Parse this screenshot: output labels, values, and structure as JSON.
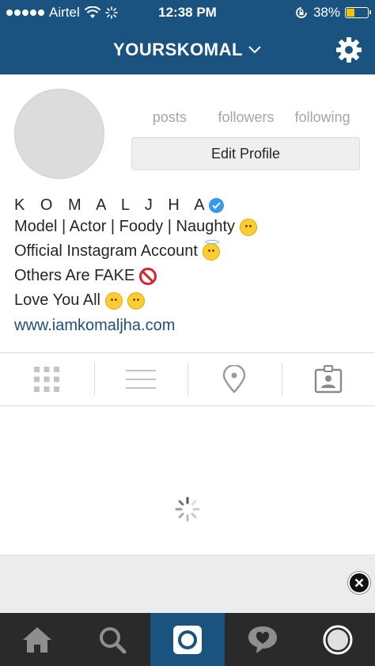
{
  "status_bar": {
    "carrier": "Airtel",
    "time": "12:38 PM",
    "battery_percent": "38%",
    "battery_level": 0.38
  },
  "nav": {
    "username": "YOURSKOMAL"
  },
  "profile": {
    "stats": [
      {
        "label": "posts"
      },
      {
        "label": "followers"
      },
      {
        "label": "following"
      }
    ],
    "edit_profile_label": "Edit Profile",
    "name": "K O M A L   J H A",
    "bio_lines": [
      "Model | Actor | Foody | Naughty",
      "Official Instagram Account",
      "Others Are FAKE",
      "Love You All"
    ],
    "website": "www.iamkomaljha.com"
  },
  "tabs": [
    {
      "icon": "grid-icon"
    },
    {
      "icon": "list-icon"
    },
    {
      "icon": "location-pin-icon"
    },
    {
      "icon": "tagged-photos-icon"
    }
  ],
  "bottom_nav": [
    {
      "icon": "home-icon"
    },
    {
      "icon": "search-icon"
    },
    {
      "icon": "camera-icon",
      "active": true
    },
    {
      "icon": "activity-heart-icon"
    },
    {
      "icon": "profile-icon"
    }
  ],
  "colors": {
    "header_blue": "#1b5380",
    "link_blue": "#1f4f7a",
    "verified_blue": "#3897f0",
    "bottom_bar": "#2a2a2a"
  }
}
